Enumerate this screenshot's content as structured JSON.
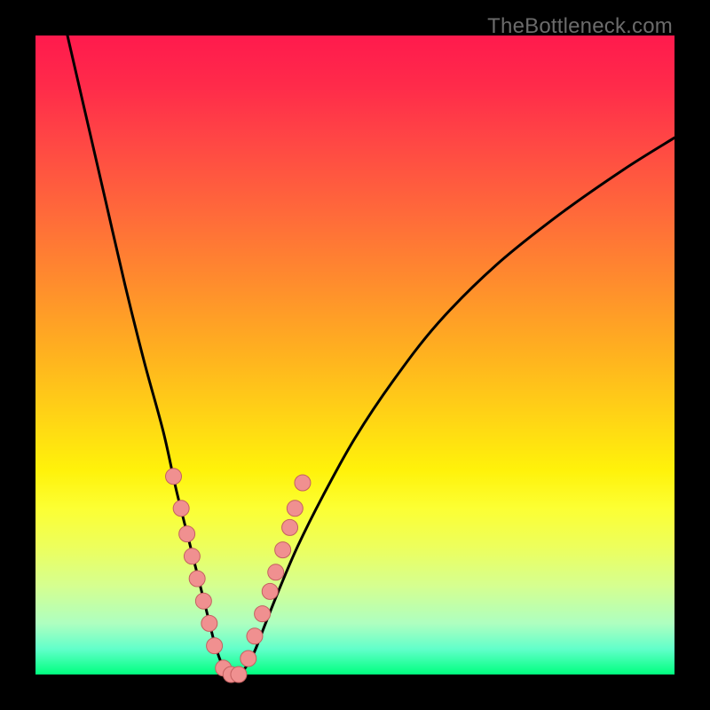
{
  "watermark": "TheBottleneck.com",
  "colors": {
    "background": "#000000",
    "curve": "#000000",
    "markers_fill": "#f09090",
    "markers_stroke": "#c46060",
    "gradient_top": "#ff1a4d",
    "gradient_bottom": "#00ff7f"
  },
  "chart_data": {
    "type": "line",
    "title": "",
    "xlabel": "",
    "ylabel": "",
    "xlim": [
      0,
      100
    ],
    "ylim": [
      0,
      100
    ],
    "grid": false,
    "legend": false,
    "series": [
      {
        "name": "bottleneck-curve",
        "x": [
          5,
          8,
          11,
          14,
          17,
          20,
          22,
          24,
          25,
          26,
          27,
          28,
          29,
          30,
          31,
          32,
          34,
          36,
          38,
          41,
          45,
          50,
          56,
          63,
          72,
          82,
          92,
          100
        ],
        "y": [
          100,
          87,
          74,
          61,
          49,
          38,
          29,
          21,
          17,
          13,
          9,
          5,
          2,
          0,
          0,
          0,
          3,
          8,
          13,
          20,
          28,
          37,
          46,
          55,
          64,
          72,
          79,
          84
        ]
      }
    ],
    "markers": {
      "name": "highlighted-points",
      "x": [
        21.6,
        22.8,
        23.7,
        24.5,
        25.3,
        26.3,
        27.2,
        28.0,
        29.4,
        30.6,
        31.8,
        33.3,
        34.3,
        35.5,
        36.7,
        37.6,
        38.7,
        39.8,
        40.6,
        41.8
      ],
      "y": [
        31.0,
        26.0,
        22.0,
        18.5,
        15.0,
        11.5,
        8.0,
        4.5,
        1.0,
        0.0,
        0.0,
        2.5,
        6.0,
        9.5,
        13.0,
        16.0,
        19.5,
        23.0,
        26.0,
        30.0
      ]
    }
  }
}
